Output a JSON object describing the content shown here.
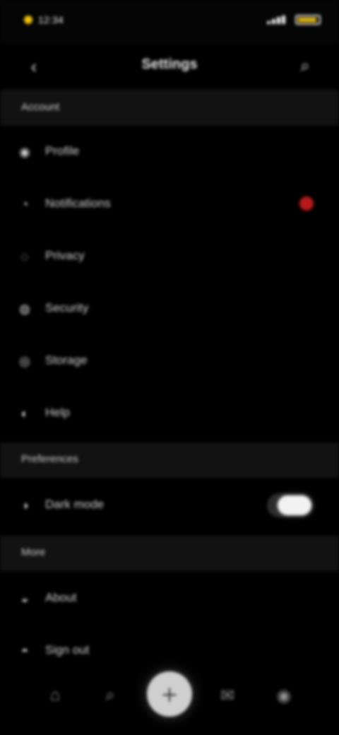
{
  "status_bar": {
    "time": "12:34",
    "icons": [
      "notification-dot",
      "signal-icon",
      "battery-icon"
    ]
  },
  "app_bar": {
    "title": "Settings",
    "back_icon": "back-icon",
    "search_icon": "search-icon"
  },
  "sections": [
    {
      "label": "Account"
    },
    {
      "label": "Preferences"
    },
    {
      "label": "More"
    }
  ],
  "rows": [
    {
      "label": "Profile",
      "icon": "person-icon"
    },
    {
      "label": "Notifications",
      "icon": "bell-icon",
      "badge_color": "#b51919"
    },
    {
      "label": "Privacy",
      "icon": "lock-icon"
    },
    {
      "label": "Security",
      "icon": "shield-icon"
    },
    {
      "label": "Storage",
      "icon": "folder-icon"
    },
    {
      "label": "Help",
      "icon": "help-icon"
    },
    {
      "label": "Dark mode",
      "icon": "moon-icon",
      "toggle_on": true
    },
    {
      "label": "About",
      "icon": "info-icon"
    },
    {
      "label": "Sign out",
      "icon": "exit-icon"
    }
  ],
  "bottom_nav": [
    {
      "label": "Home",
      "icon": "home-icon"
    },
    {
      "label": "Search",
      "icon": "search-icon"
    },
    {
      "label": "Add",
      "icon": "plus-icon",
      "active": true
    },
    {
      "label": "Messages",
      "icon": "chat-icon"
    },
    {
      "label": "Profile",
      "icon": "user-icon"
    }
  ]
}
